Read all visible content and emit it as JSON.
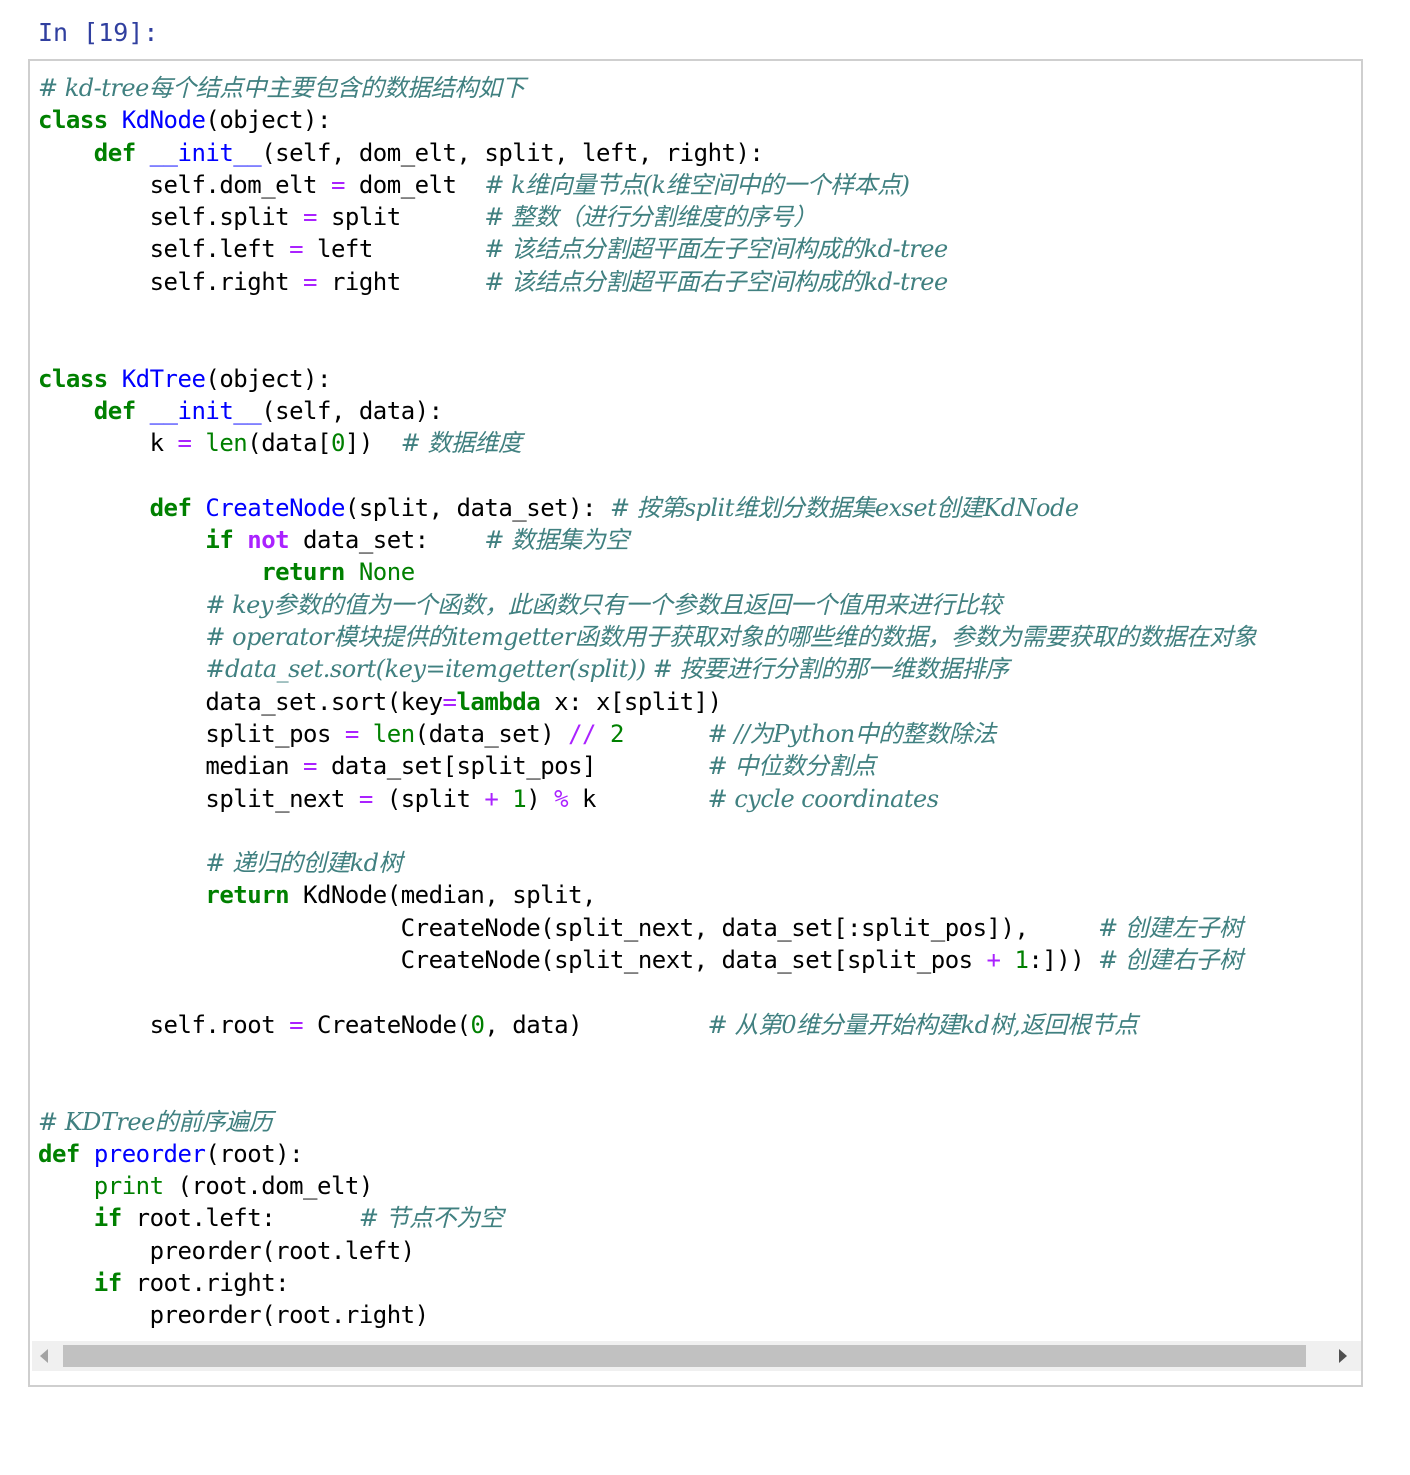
{
  "cell": {
    "prompt": "In [19]:",
    "lines": [
      [
        {
          "t": "# kd-tree每个结点中主要包含的数据结构如下",
          "c": "cm"
        }
      ],
      [
        {
          "t": "class",
          "c": "kw"
        },
        {
          "t": " ",
          "c": "txt"
        },
        {
          "t": "KdNode",
          "c": "cls"
        },
        {
          "t": "(object):",
          "c": "txt"
        }
      ],
      [
        {
          "t": "    ",
          "c": "txt"
        },
        {
          "t": "def",
          "c": "kw"
        },
        {
          "t": " ",
          "c": "txt"
        },
        {
          "t": "__init__",
          "c": "dunder"
        },
        {
          "t": "(self, dom_elt, split, left, right):",
          "c": "txt"
        }
      ],
      [
        {
          "t": "        self.dom_elt ",
          "c": "txt"
        },
        {
          "t": "=",
          "c": "op"
        },
        {
          "t": " dom_elt  ",
          "c": "txt"
        },
        {
          "t": "# k维向量节点(k维空间中的一个样本点)",
          "c": "cm"
        }
      ],
      [
        {
          "t": "        self.split ",
          "c": "txt"
        },
        {
          "t": "=",
          "c": "op"
        },
        {
          "t": " split      ",
          "c": "txt"
        },
        {
          "t": "# 整数（进行分割维度的序号）",
          "c": "cm"
        }
      ],
      [
        {
          "t": "        self.left ",
          "c": "txt"
        },
        {
          "t": "=",
          "c": "op"
        },
        {
          "t": " left        ",
          "c": "txt"
        },
        {
          "t": "# 该结点分割超平面左子空间构成的kd-tree",
          "c": "cm"
        }
      ],
      [
        {
          "t": "        self.right ",
          "c": "txt"
        },
        {
          "t": "=",
          "c": "op"
        },
        {
          "t": " right      ",
          "c": "txt"
        },
        {
          "t": "# 该结点分割超平面右子空间构成的kd-tree",
          "c": "cm"
        }
      ],
      [],
      [],
      [
        {
          "t": "class",
          "c": "kw"
        },
        {
          "t": " ",
          "c": "txt"
        },
        {
          "t": "KdTree",
          "c": "cls"
        },
        {
          "t": "(object):",
          "c": "txt"
        }
      ],
      [
        {
          "t": "    ",
          "c": "txt"
        },
        {
          "t": "def",
          "c": "kw"
        },
        {
          "t": " ",
          "c": "txt"
        },
        {
          "t": "__init__",
          "c": "dunder"
        },
        {
          "t": "(self, data):",
          "c": "txt"
        }
      ],
      [
        {
          "t": "        k ",
          "c": "txt"
        },
        {
          "t": "=",
          "c": "op"
        },
        {
          "t": " ",
          "c": "txt"
        },
        {
          "t": "len",
          "c": "bi"
        },
        {
          "t": "(data[",
          "c": "txt"
        },
        {
          "t": "0",
          "c": "num"
        },
        {
          "t": "])  ",
          "c": "txt"
        },
        {
          "t": "# 数据维度",
          "c": "cm"
        }
      ],
      [],
      [
        {
          "t": "        ",
          "c": "txt"
        },
        {
          "t": "def",
          "c": "kw"
        },
        {
          "t": " ",
          "c": "txt"
        },
        {
          "t": "CreateNode",
          "c": "fn"
        },
        {
          "t": "(split, data_set): ",
          "c": "txt"
        },
        {
          "t": "# 按第split维划分数据集exset创建KdNode",
          "c": "cm"
        }
      ],
      [
        {
          "t": "            ",
          "c": "txt"
        },
        {
          "t": "if",
          "c": "kw"
        },
        {
          "t": " ",
          "c": "txt"
        },
        {
          "t": "not",
          "c": "ow"
        },
        {
          "t": " data_set:    ",
          "c": "txt"
        },
        {
          "t": "# 数据集为空",
          "c": "cm"
        }
      ],
      [
        {
          "t": "                ",
          "c": "txt"
        },
        {
          "t": "return",
          "c": "kw"
        },
        {
          "t": " ",
          "c": "txt"
        },
        {
          "t": "None",
          "c": "kwn"
        }
      ],
      [
        {
          "t": "            ",
          "c": "txt"
        },
        {
          "t": "# key参数的值为一个函数，此函数只有一个参数且返回一个值用来进行比较",
          "c": "cm"
        }
      ],
      [
        {
          "t": "            ",
          "c": "txt"
        },
        {
          "t": "# operator模块提供的itemgetter函数用于获取对象的哪些维的数据，参数为需要获取的数据在对象",
          "c": "cm"
        }
      ],
      [
        {
          "t": "            ",
          "c": "txt"
        },
        {
          "t": "#data_set.sort(key=itemgetter(split)) # 按要进行分割的那一维数据排序",
          "c": "cm"
        }
      ],
      [
        {
          "t": "            data_set.sort(key",
          "c": "txt"
        },
        {
          "t": "=",
          "c": "op"
        },
        {
          "t": "lambda",
          "c": "kw"
        },
        {
          "t": " x: x[split])",
          "c": "txt"
        }
      ],
      [
        {
          "t": "            split_pos ",
          "c": "txt"
        },
        {
          "t": "=",
          "c": "op"
        },
        {
          "t": " ",
          "c": "txt"
        },
        {
          "t": "len",
          "c": "bi"
        },
        {
          "t": "(data_set) ",
          "c": "txt"
        },
        {
          "t": "//",
          "c": "op"
        },
        {
          "t": " ",
          "c": "txt"
        },
        {
          "t": "2",
          "c": "num"
        },
        {
          "t": "      ",
          "c": "txt"
        },
        {
          "t": "# //为Python中的整数除法",
          "c": "cm"
        }
      ],
      [
        {
          "t": "            median ",
          "c": "txt"
        },
        {
          "t": "=",
          "c": "op"
        },
        {
          "t": " data_set[split_pos]        ",
          "c": "txt"
        },
        {
          "t": "# 中位数分割点",
          "c": "cm"
        }
      ],
      [
        {
          "t": "            split_next ",
          "c": "txt"
        },
        {
          "t": "=",
          "c": "op"
        },
        {
          "t": " (split ",
          "c": "txt"
        },
        {
          "t": "+",
          "c": "op"
        },
        {
          "t": " ",
          "c": "txt"
        },
        {
          "t": "1",
          "c": "num"
        },
        {
          "t": ") ",
          "c": "txt"
        },
        {
          "t": "%",
          "c": "op"
        },
        {
          "t": " k        ",
          "c": "txt"
        },
        {
          "t": "# cycle coordinates",
          "c": "cm"
        }
      ],
      [],
      [
        {
          "t": "            ",
          "c": "txt"
        },
        {
          "t": "# 递归的创建kd树",
          "c": "cm"
        }
      ],
      [
        {
          "t": "            ",
          "c": "txt"
        },
        {
          "t": "return",
          "c": "kw"
        },
        {
          "t": " KdNode(median, split,",
          "c": "txt"
        }
      ],
      [
        {
          "t": "                          CreateNode(split_next, data_set[:split_pos]),     ",
          "c": "txt"
        },
        {
          "t": "# 创建左子树",
          "c": "cm"
        }
      ],
      [
        {
          "t": "                          CreateNode(split_next, data_set[split_pos ",
          "c": "txt"
        },
        {
          "t": "+",
          "c": "op"
        },
        {
          "t": " ",
          "c": "txt"
        },
        {
          "t": "1",
          "c": "num"
        },
        {
          "t": ":])) ",
          "c": "txt"
        },
        {
          "t": "# 创建右子树",
          "c": "cm"
        }
      ],
      [],
      [
        {
          "t": "        self.root ",
          "c": "txt"
        },
        {
          "t": "=",
          "c": "op"
        },
        {
          "t": " CreateNode(",
          "c": "txt"
        },
        {
          "t": "0",
          "c": "num"
        },
        {
          "t": ", data)         ",
          "c": "txt"
        },
        {
          "t": "# 从第0维分量开始构建kd树,返回根节点",
          "c": "cm"
        }
      ],
      [],
      [],
      [
        {
          "t": "# KDTree的前序遍历",
          "c": "cm"
        }
      ],
      [
        {
          "t": "def",
          "c": "kw"
        },
        {
          "t": " ",
          "c": "txt"
        },
        {
          "t": "preorder",
          "c": "def"
        },
        {
          "t": "(root):",
          "c": "txt"
        }
      ],
      [
        {
          "t": "    ",
          "c": "txt"
        },
        {
          "t": "print",
          "c": "bi"
        },
        {
          "t": " (root.dom_elt)",
          "c": "txt"
        }
      ],
      [
        {
          "t": "    ",
          "c": "txt"
        },
        {
          "t": "if",
          "c": "kw"
        },
        {
          "t": " root.left:      ",
          "c": "txt"
        },
        {
          "t": "# 节点不为空",
          "c": "cm"
        }
      ],
      [
        {
          "t": "        preorder(root.left)",
          "c": "txt"
        }
      ],
      [
        {
          "t": "    ",
          "c": "txt"
        },
        {
          "t": "if",
          "c": "kw"
        },
        {
          "t": " root.right:",
          "c": "txt"
        }
      ],
      [
        {
          "t": "        preorder(root.right)",
          "c": "txt"
        }
      ]
    ]
  },
  "scrollbar": {
    "left_arrow_icon": "triangle-left-icon",
    "right_arrow_icon": "triangle-right-icon"
  },
  "colors": {
    "prompt": "#303f9f",
    "keyword": "#008000",
    "class_name": "#0000ff",
    "comment": "#408080",
    "operator": "#aa22ff",
    "number": "#008000",
    "cell_border": "#cfcfcf"
  }
}
